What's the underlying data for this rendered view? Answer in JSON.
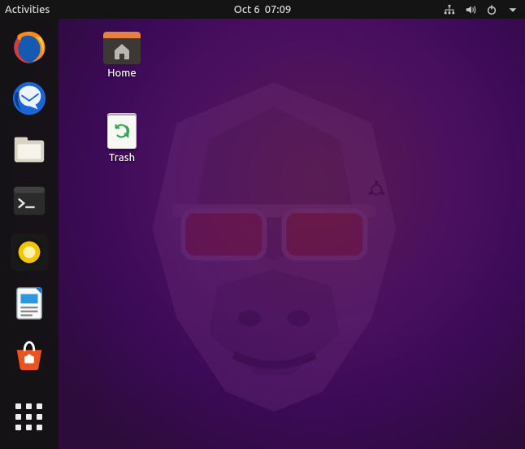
{
  "topbar": {
    "activities": "Activities",
    "date": "Oct 6",
    "time": "07:09"
  },
  "dock": {
    "items": [
      {
        "name": "firefox",
        "label": "Firefox Web Browser"
      },
      {
        "name": "thunderbird",
        "label": "Thunderbird Mail"
      },
      {
        "name": "files",
        "label": "Files"
      },
      {
        "name": "terminal",
        "label": "Terminal"
      },
      {
        "name": "rhythmbox",
        "label": "Rhythmbox"
      },
      {
        "name": "libreoffice-writer",
        "label": "LibreOffice Writer"
      },
      {
        "name": "software",
        "label": "Ubuntu Software"
      }
    ],
    "apps_button": "Show Applications"
  },
  "desktop_icons": {
    "home": "Home",
    "trash": "Trash"
  },
  "tray_icons": [
    "network",
    "volume",
    "power",
    "dropdown"
  ],
  "wallpaper": "Ubuntu 20.10 Groovy Gorilla"
}
